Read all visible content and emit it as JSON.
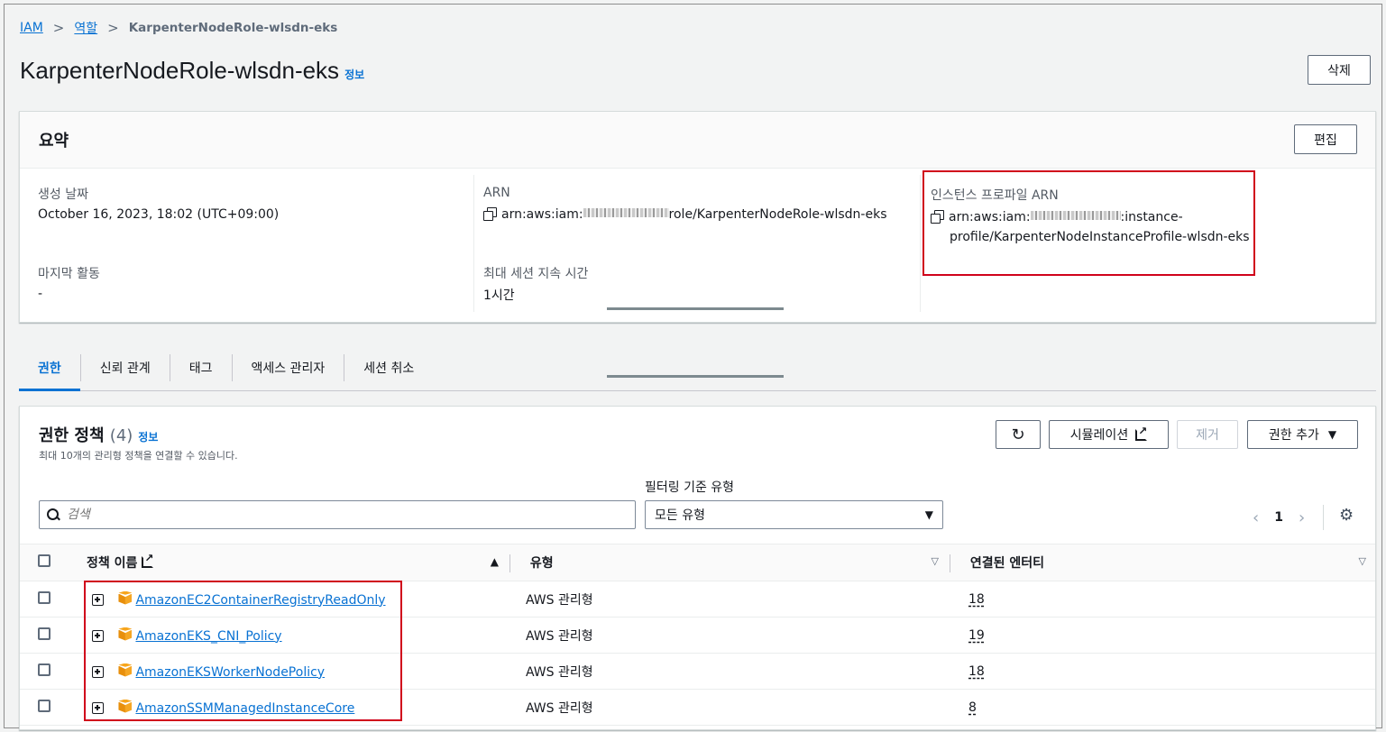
{
  "breadcrumb": {
    "items": [
      "IAM",
      "역할"
    ],
    "current": "KarpenterNodeRole-wlsdn-eks"
  },
  "page": {
    "title": "KarpenterNodeRole-wlsdn-eks",
    "info": "정보",
    "delete_label": "삭제"
  },
  "summary": {
    "title": "요약",
    "edit_label": "편집",
    "created_label": "생성 날짜",
    "created_value": "October 16, 2023, 18:02 (UTC+09:00)",
    "last_activity_label": "마지막 활동",
    "last_activity_value": "-",
    "arn_label": "ARN",
    "arn_prefix": "arn:aws:iam:",
    "arn_suffix": "role/KarpenterNodeRole-wlsdn-eks",
    "max_session_label": "최대 세션 지속 시간",
    "max_session_value": "1시간",
    "instance_profile_label": "인스턴스 프로파일 ARN",
    "instance_profile_prefix": "arn:aws:iam:",
    "instance_profile_mid": ":instance-",
    "instance_profile_line2": "profile/KarpenterNodeInstanceProfile-wlsdn-eks"
  },
  "tabs": [
    {
      "label": "권한",
      "active": true
    },
    {
      "label": "신뢰 관계",
      "active": false
    },
    {
      "label": "태그",
      "active": false
    },
    {
      "label": "액세스 관리자",
      "active": false
    },
    {
      "label": "세션 취소",
      "active": false
    }
  ],
  "permissions": {
    "title": "권한 정책",
    "count": "(4)",
    "info": "정보",
    "description": "최대 10개의 관리형 정책을 연결할 수 있습니다.",
    "refresh_icon": "refresh-icon",
    "simulation_label": "시뮬레이션",
    "remove_label": "제거",
    "add_label": "권한 추가",
    "search_placeholder": "검색",
    "filter_label": "필터링 기준 유형",
    "filter_value": "모든 유형",
    "page_number": "1",
    "columns": {
      "name": "정책 이름",
      "type": "유형",
      "entities": "연결된 엔터티"
    },
    "rows": [
      {
        "name": "AmazonEC2ContainerRegistryReadOnly",
        "type": "AWS 관리형",
        "entities": "18"
      },
      {
        "name": "AmazonEKS_CNI_Policy",
        "type": "AWS 관리형",
        "entities": "19"
      },
      {
        "name": "AmazonEKSWorkerNodePolicy",
        "type": "AWS 관리형",
        "entities": "18"
      },
      {
        "name": "AmazonSSMManagedInstanceCore",
        "type": "AWS 관리형",
        "entities": "8"
      }
    ]
  },
  "colors": {
    "link": "#0972d3",
    "highlight_box": "#d0021b",
    "policy_icon": "#f5a623"
  }
}
